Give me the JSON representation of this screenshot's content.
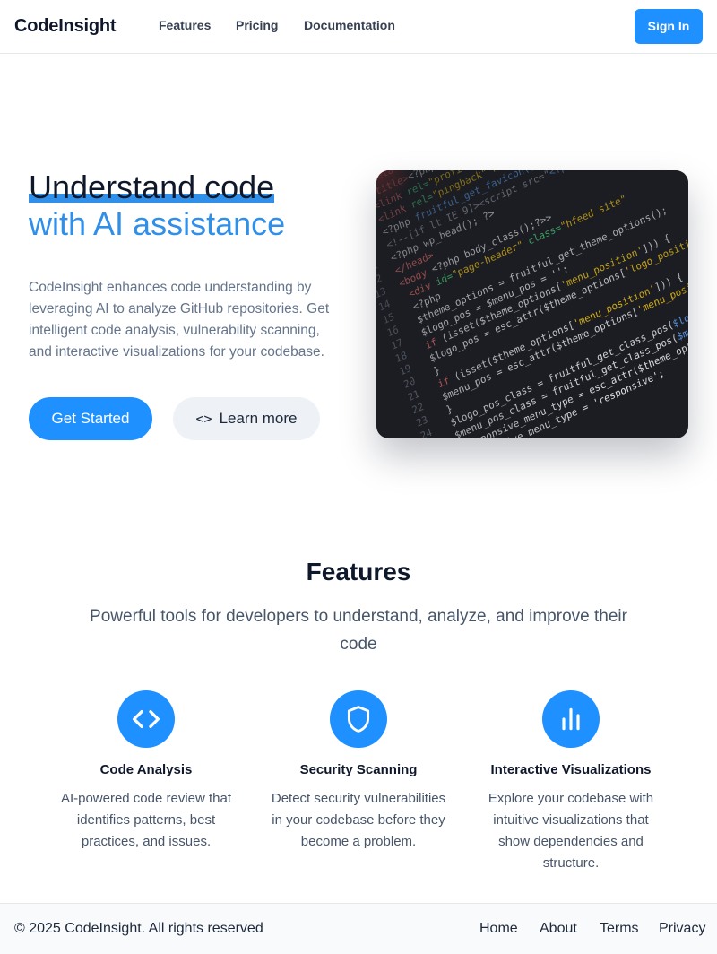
{
  "header": {
    "brand": "CodeInsight",
    "nav": [
      "Features",
      "Pricing",
      "Documentation"
    ],
    "sign_in": "Sign In"
  },
  "hero": {
    "title_line1": "Understand code",
    "title_line2": "with AI assistance",
    "description": "CodeInsight enhances code understanding by leveraging AI to analyze GitHub repositories. Get intelligent code analysis, vulnerability scanning, and interactive visualizations for your codebase.",
    "primary_button": "Get Started",
    "secondary_button": "Learn more",
    "secondary_icon": "code-icon"
  },
  "features": {
    "title": "Features",
    "subtitle": "Powerful tools for developers to understand, analyze, and improve their code",
    "items": [
      {
        "icon": "code-icon",
        "name": "Code Analysis",
        "description": "AI-powered code review that identifies patterns, best practices, and issues."
      },
      {
        "icon": "shield-icon",
        "name": "Security Scanning",
        "description": "Detect security vulnerabilities in your codebase before they become a problem."
      },
      {
        "icon": "bar-chart-icon",
        "name": "Interactive Visualizations",
        "description": "Explore your codebase with intuitive visualizations that show dependencies and structure."
      }
    ]
  },
  "footer": {
    "copyright": "© 2025 CodeInsight. All rights reserved",
    "links": [
      "Home",
      "About",
      "Terms",
      "Privacy"
    ]
  },
  "colors": {
    "accent": "#1e90ff",
    "accent_text": "#2f8fe9",
    "text_dark": "#0f172a",
    "text_muted": "#64748b"
  }
}
